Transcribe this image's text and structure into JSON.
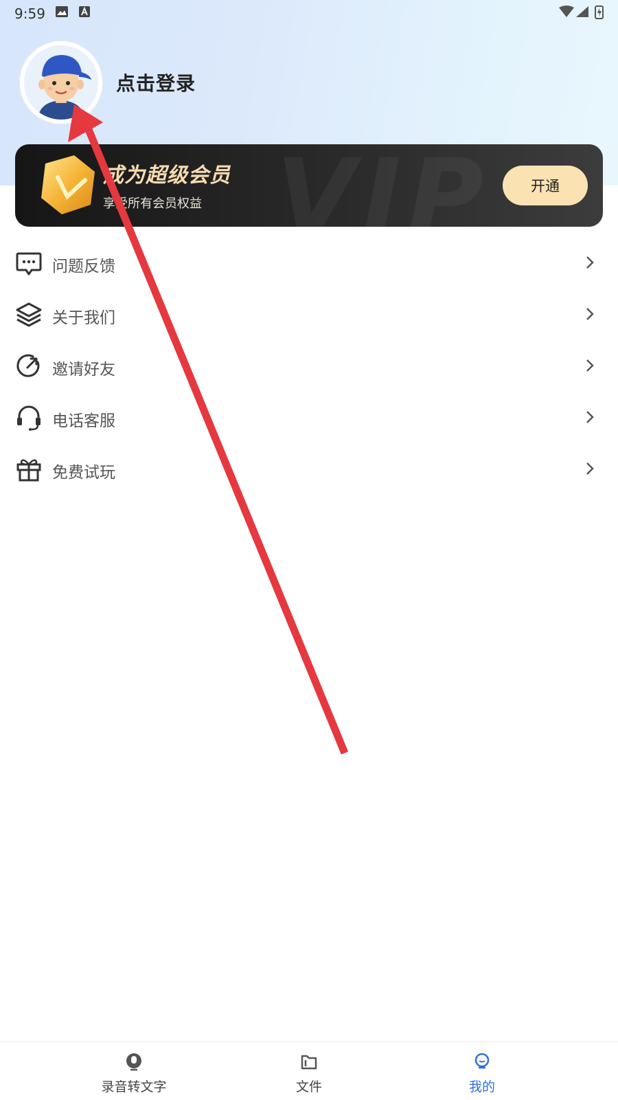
{
  "status_bar": {
    "time": "9:59"
  },
  "profile": {
    "login_text": "点击登录"
  },
  "vip": {
    "watermark": "VIP",
    "title": "成为超级会员",
    "subtitle": "享受所有会员权益",
    "button_label": "开通"
  },
  "menu": {
    "items": [
      {
        "label": "问题反馈",
        "icon": "feedback-icon"
      },
      {
        "label": "关于我们",
        "icon": "layers-icon"
      },
      {
        "label": "邀请好友",
        "icon": "share-icon"
      },
      {
        "label": "电话客服",
        "icon": "headset-icon"
      },
      {
        "label": "免费试玩",
        "icon": "gift-icon"
      }
    ]
  },
  "bottom_nav": {
    "tabs": [
      {
        "label": "录音转文字",
        "icon": "microphone-icon",
        "active": false
      },
      {
        "label": "文件",
        "icon": "folder-icon",
        "active": false
      },
      {
        "label": "我的",
        "icon": "profile-icon",
        "active": true
      }
    ]
  },
  "colors": {
    "accent": "#2f6fe0",
    "annotation_arrow": "#e5383f",
    "vip_gold": "#fbe2b3"
  }
}
